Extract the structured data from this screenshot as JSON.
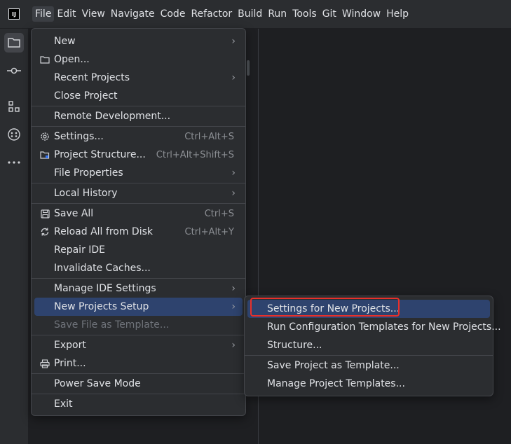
{
  "app": {
    "logo_text": "IJ"
  },
  "menubar": {
    "items": [
      "File",
      "Edit",
      "View",
      "Navigate",
      "Code",
      "Refactor",
      "Build",
      "Run",
      "Tools",
      "Git",
      "Window",
      "Help"
    ]
  },
  "sidebar": {
    "items": [
      "folder-icon",
      "commit-icon",
      "structure-icon",
      "plugins-icon",
      "more-icon"
    ]
  },
  "file_menu": {
    "new": "New",
    "open": "Open...",
    "recent_projects": "Recent Projects",
    "close_project": "Close Project",
    "remote_development": "Remote Development...",
    "settings": "Settings...",
    "settings_shortcut": "Ctrl+Alt+S",
    "project_structure": "Project Structure...",
    "project_structure_shortcut": "Ctrl+Alt+Shift+S",
    "file_properties": "File Properties",
    "local_history": "Local History",
    "save_all": "Save All",
    "save_all_shortcut": "Ctrl+S",
    "reload_all": "Reload All from Disk",
    "reload_all_shortcut": "Ctrl+Alt+Y",
    "repair_ide": "Repair IDE",
    "invalidate_caches": "Invalidate Caches...",
    "manage_ide_settings": "Manage IDE Settings",
    "new_projects_setup": "New Projects Setup",
    "save_file_as_template": "Save File as Template...",
    "export": "Export",
    "print": "Print...",
    "power_save_mode": "Power Save Mode",
    "exit": "Exit"
  },
  "submenu": {
    "settings_for_new_projects": "Settings for New Projects...",
    "run_configuration_templates": "Run Configuration Templates for New Projects...",
    "structure": "Structure...",
    "save_project_as_template": "Save Project as Template...",
    "manage_project_templates": "Manage Project Templates..."
  },
  "colors": {
    "background": "#1e1f22",
    "panel": "#2b2d30",
    "selection": "#2e436e",
    "highlight_box": "#e8302a"
  }
}
